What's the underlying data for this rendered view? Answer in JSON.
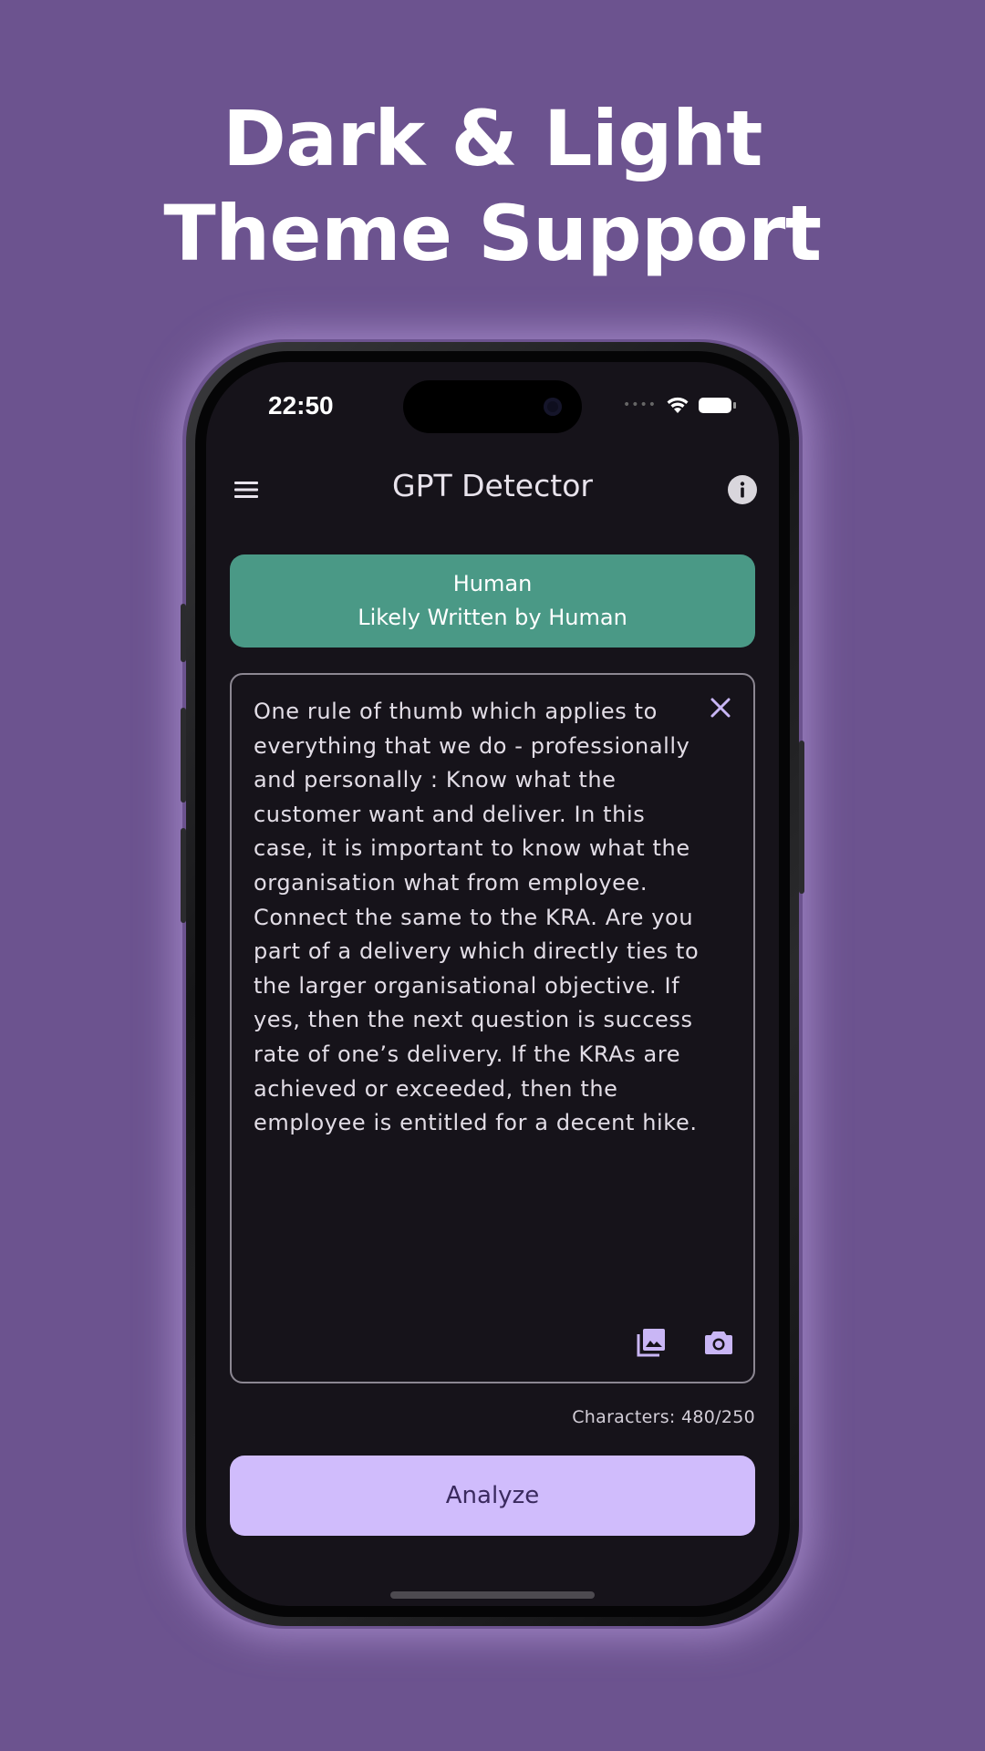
{
  "headline": {
    "line1": "Dark & Light",
    "line2": "Theme Support"
  },
  "status_bar": {
    "time": "22:50",
    "signal": "••••"
  },
  "app_bar": {
    "title": "GPT Detector",
    "menu_icon": "hamburger-menu-icon",
    "info_icon": "info-icon"
  },
  "result": {
    "label": "Human",
    "description": "Likely Written by Human",
    "color": "#4a9986"
  },
  "input": {
    "text": "One rule of thumb which applies to everything that we do - professionally and personally : Know what the customer want and deliver. In this case, it is important to know what the organisation what from employee. Connect the same to the KRA. Are you part of a delivery which directly ties to the larger organisational objective. If yes, then the next question is success rate of one’s delivery. If the KRAs are achieved or exceeded, then the employee is entitled for a decent hike.",
    "clear_icon": "close-icon",
    "gallery_icon": "image-gallery-icon",
    "camera_icon": "camera-icon"
  },
  "char_counter": "Characters: 480/250",
  "analyze_button": "Analyze",
  "colors": {
    "background": "#6c538f",
    "screen": "#16131a",
    "accent": "#d0bcfc"
  }
}
